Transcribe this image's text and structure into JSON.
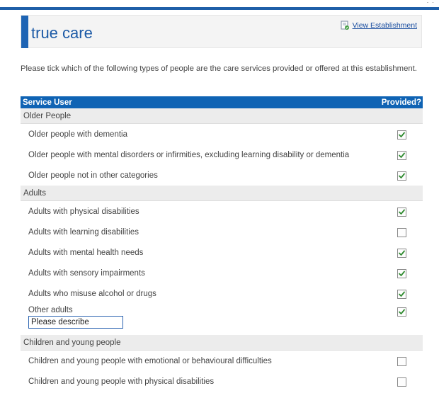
{
  "window": {
    "corner_text": "· ·"
  },
  "header": {
    "title": "true care",
    "view_link": "View Establishment"
  },
  "intro": "Please tick which of the following types of people are the care services provided or offered at this establishment.",
  "table": {
    "col_service": "Service User",
    "col_provided": "Provided?",
    "groups": [
      {
        "name": "Older People",
        "items": [
          {
            "label": "Older people with dementia",
            "checked": true
          },
          {
            "label": "Older people with mental disorders or infirmities, excluding learning disability or dementia",
            "checked": true
          },
          {
            "label": "Older people not in other categories",
            "checked": true
          }
        ]
      },
      {
        "name": "Adults",
        "items": [
          {
            "label": "Adults with physical disabilities",
            "checked": true
          },
          {
            "label": "Adults with learning disabilities",
            "checked": false
          },
          {
            "label": "Adults with mental health needs",
            "checked": true
          },
          {
            "label": "Adults with sensory impairments",
            "checked": true
          },
          {
            "label": "Adults who misuse alcohol or drugs",
            "checked": true
          },
          {
            "label": "Other adults",
            "checked": true,
            "input_value": "Please describe"
          }
        ]
      },
      {
        "name": "Children and young people",
        "items": [
          {
            "label": "Children and young people with emotional or behavioural difficulties",
            "checked": false
          },
          {
            "label": "Children and young people with physical disabilities",
            "checked": false
          }
        ]
      }
    ]
  },
  "colors": {
    "accent": "#0f63b4",
    "check": "#2f8a2f"
  }
}
